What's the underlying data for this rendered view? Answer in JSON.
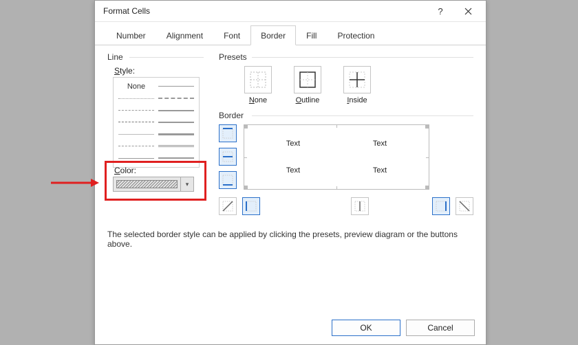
{
  "title": "Format Cells",
  "tabs": [
    "Number",
    "Alignment",
    "Font",
    "Border",
    "Fill",
    "Protection"
  ],
  "active_tab": "Border",
  "line": {
    "header": "Line",
    "style_label": "Style:",
    "none_label": "None"
  },
  "color": {
    "label": "Color:"
  },
  "presets": {
    "header": "Presets",
    "items": [
      {
        "key": "none",
        "label": "None",
        "u": "N"
      },
      {
        "key": "outline",
        "label": "Outline",
        "u": "O"
      },
      {
        "key": "inside",
        "label": "Inside",
        "u": "I"
      }
    ]
  },
  "border": {
    "header": "Border",
    "preview_text": "Text"
  },
  "hint": "The selected border style can be applied by clicking the presets, preview diagram or the buttons above.",
  "buttons": {
    "ok": "OK",
    "cancel": "Cancel"
  }
}
